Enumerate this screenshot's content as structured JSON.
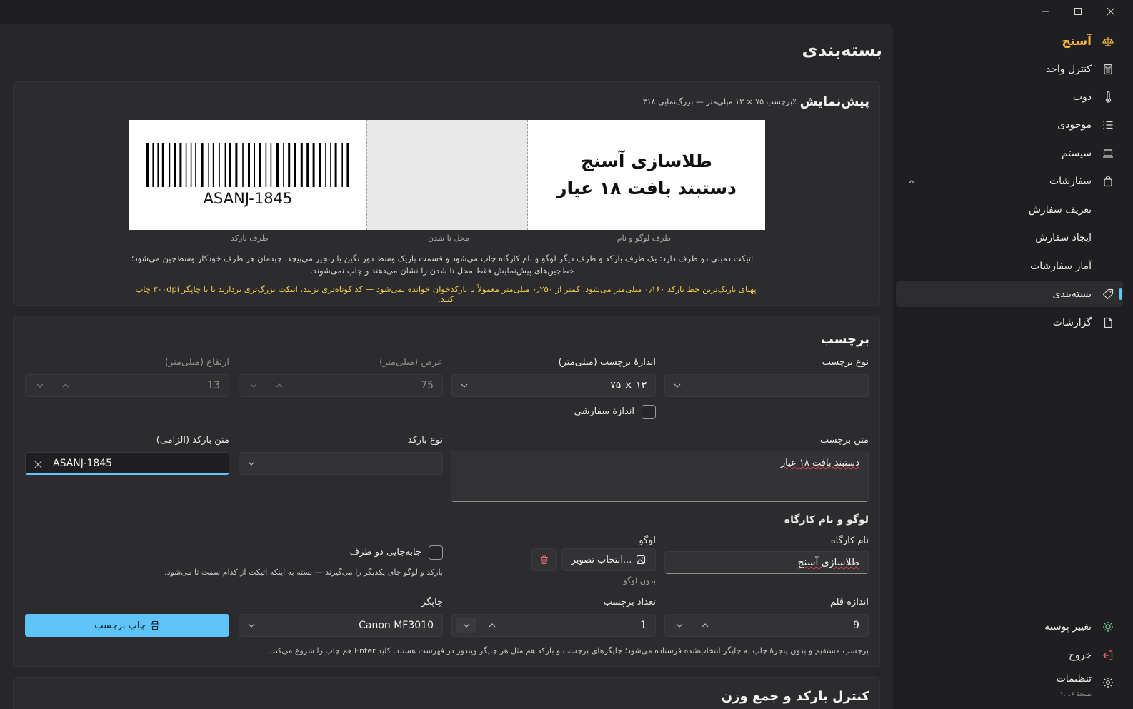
{
  "app": {
    "brand": "آسنج",
    "version": "نسخهٔ ۱.۰.۶"
  },
  "nav": {
    "items": [
      {
        "label": "کنترل واحد",
        "icon": "calculator-icon"
      },
      {
        "label": "ذوب",
        "icon": "thermometer-icon"
      },
      {
        "label": "موجودی",
        "icon": "list-icon"
      },
      {
        "label": "سیستم",
        "icon": "laptop-icon"
      },
      {
        "label": "سفارشات",
        "icon": "bag-icon"
      },
      {
        "label": "تعریف سفارش"
      },
      {
        "label": "ایجاد سفارش"
      },
      {
        "label": "آمار سفارشات"
      },
      {
        "label": "بسته‌بندی",
        "icon": "tag-icon"
      },
      {
        "label": "گزارشات",
        "icon": "document-icon"
      }
    ],
    "theme": "تغییر پوسته",
    "logout": "خروج",
    "settings": "تنظیمات"
  },
  "page": {
    "title": "بسته‌بندی"
  },
  "preview": {
    "title": "پیش‌نمایش",
    "subtitle": "برچسب ۷۵ × ۱۳ میلی‌متر — بزرگ‌نمایی ۳۱۸٪",
    "logo_line1": "طلاسازی آسنج",
    "logo_line2": "دستبند بافت ۱۸ عیار",
    "barcode_text": "ASANJ-1845",
    "zone_logo": "طرف لوگو و نام",
    "zone_fold": "محل تا شدن",
    "zone_barcode": "طرف بارکد",
    "desc_line1": "اتیکت دمبلی دو طرف دارد: یک طرف بارکد و طرف دیگر لوگو و نام کارگاه چاپ می‌شود و قسمت باریک وسط دور نگین یا زنجیر می‌پیچد. چیدمان هر طرف خودکار وسط‌چین می‌شود؛",
    "desc_line2": "خط‌چین‌های پیش‌نمایش فقط محل تا شدن را نشان می‌دهند و چاپ نمی‌شوند.",
    "warning": "پهنای باریک‌ترین خط بارکد ۰٫۱۶۰ میلی‌متر می‌شود. کمتر از ۰٫۲۵۰ میلی‌متر معمولاً با بارکدخوان خوانده نمی‌شود — کد کوتاه‌تری بزنید، اتیکت بزرگ‌تری بردارید یا با چاپگر ۳۰۰dpi چاپ کنید."
  },
  "label": {
    "title": "برچسب",
    "type_label": "نوع برچسب",
    "type_value": "",
    "size_label": "اندازهٔ برچسب (میلی‌متر)",
    "size_value": "۷۵ × ۱۳",
    "width_label": "عرض (میلی‌متر)",
    "width_value": "75",
    "height_label": "ارتفاع (میلی‌متر)",
    "height_value": "13",
    "custom_size": "اندازهٔ سفارشی",
    "text_label": "متن برچسب",
    "text_value": "دستبند بافت ۱۸ عیار",
    "barcode_type_label": "نوع بارکد",
    "barcode_type_value": "",
    "barcode_text_label": "متن بارکد (الزامی)",
    "barcode_text_value": "ASANJ-1845",
    "logo_section": "لوگو و نام کارگاه",
    "workshop_label": "نام کارگاه",
    "workshop_value": "طلاسازی آسنج",
    "logo_label": "لوگو",
    "choose_image": "انتخاب تصویر...",
    "no_logo": "بدون لوگو",
    "swap_label": "جابه‌جایی دو طرف",
    "swap_note": "بارکد و لوگو جای یکدیگر را می‌گیرند — بسته به اینکه اتیکت از کدام سمت تا می‌شود.",
    "font_size_label": "اندازه قلم",
    "font_size_value": "9",
    "count_label": "تعداد برچسب",
    "count_value": "1",
    "printer_label": "چاپگر",
    "printer_value": "Canon MF3010",
    "print_button": "چاپ برچسب",
    "print_note": "برچسب مستقیم و بدون پنجرهٔ چاپ به چاپگر انتخاب‌شده فرستاده می‌شود؛ چاپگرهای برچسب و بارکد هم مثل هر چاپگر ویندوز در فهرست هستند. کلید Enter هم چاپ را شروع می‌کند."
  },
  "next_section": {
    "title": "کنترل بارکد و جمع وزن"
  }
}
